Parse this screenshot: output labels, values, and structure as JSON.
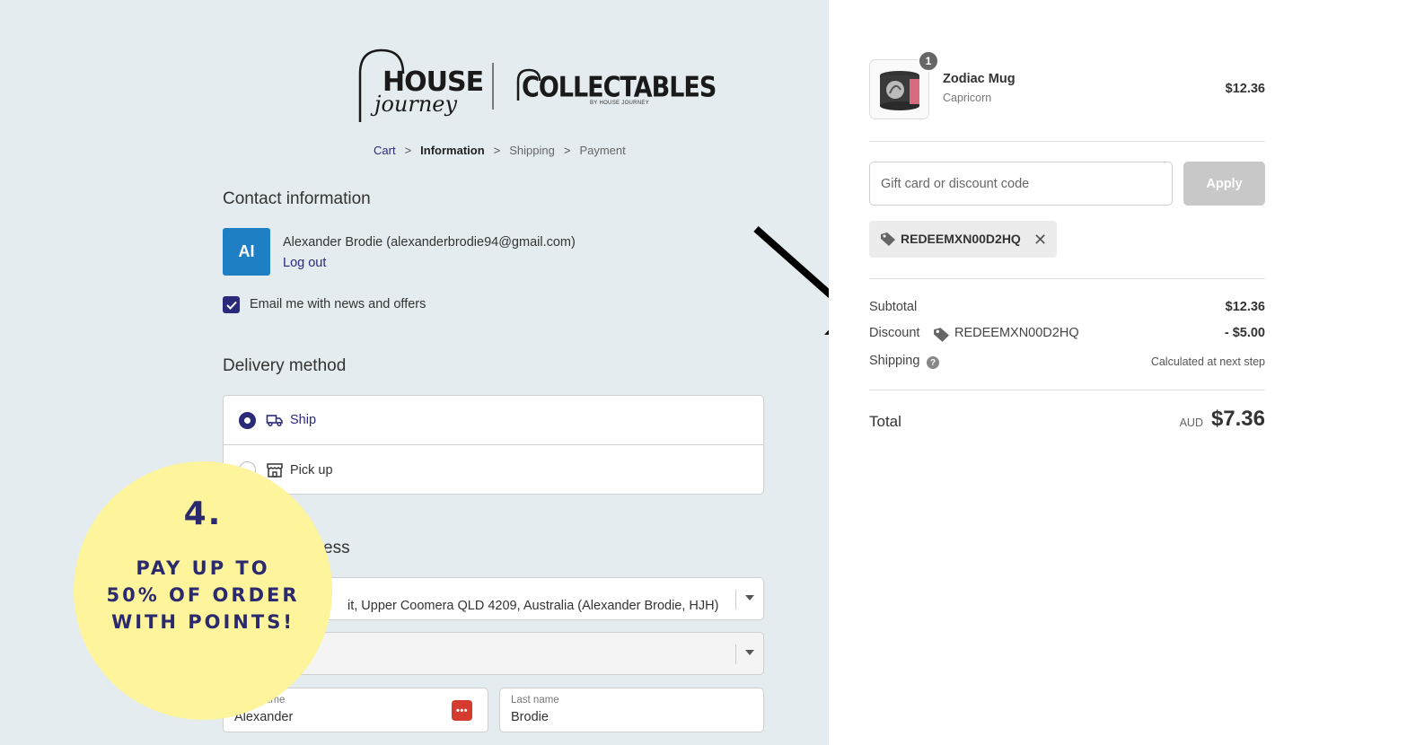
{
  "brand": {
    "house_word": "HOUSE",
    "journey_word": "journey",
    "collectables_word": "COLLECTABLES",
    "collectables_sub": "BY HOUSE JOURNEY"
  },
  "breadcrumb": {
    "items": [
      "Cart",
      "Information",
      "Shipping",
      "Payment"
    ],
    "separator": ">"
  },
  "contact": {
    "title": "Contact information",
    "avatar_text": "AI",
    "name_email": "Alexander Brodie (alexanderbrodie94@gmail.com)",
    "logout": "Log out",
    "newsletter_label": "Email me with news and offers",
    "newsletter_checked": true
  },
  "delivery": {
    "title": "Delivery method",
    "options": [
      "Ship",
      "Pick up"
    ],
    "selected": "Ship"
  },
  "shipping_address": {
    "title_visible": "ess",
    "saved_address": "it, Upper Coomera QLD 4209, Australia (Alexander Brodie, HJH)",
    "first_name_label": "ame",
    "first_name_value": "Alexander",
    "last_name_label": "Last name",
    "last_name_value": "Brodie"
  },
  "promo": {
    "number": "4.",
    "line1": "PAY UP TO",
    "line2": "50% OF ORDER",
    "line3": "WITH POINTS!"
  },
  "colors": {
    "accent": "#2b2a7a",
    "left_bg": "#e4ecef",
    "promo_bg": "#fdf49b"
  },
  "order": {
    "item": {
      "quantity": "1",
      "name": "Zodiac Mug",
      "variant": "Capricorn",
      "price": "$12.36"
    },
    "discount_placeholder": "Gift card or discount code",
    "apply_label": "Apply",
    "applied_code": "REDEEMXN00D2HQ",
    "summary": {
      "subtotal_label": "Subtotal",
      "subtotal_value": "$12.36",
      "discount_label": "Discount",
      "discount_code": "REDEEMXN00D2HQ",
      "discount_value": "- $5.00",
      "shipping_label": "Shipping",
      "shipping_value": "Calculated at next step"
    },
    "total_label": "Total",
    "total_currency": "AUD",
    "total_value": "$7.36"
  }
}
